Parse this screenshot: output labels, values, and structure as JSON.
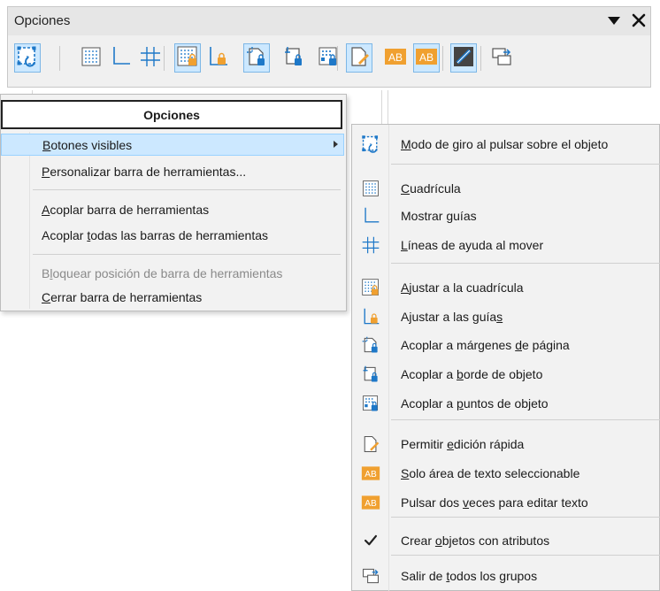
{
  "toolbar": {
    "title": "Opciones",
    "buttons": [
      {
        "icon": "rotate-mode-icon",
        "active": true
      },
      {
        "icon": "grid-icon",
        "active": false
      },
      {
        "icon": "guides-icon",
        "active": false
      },
      {
        "icon": "helplines-icon",
        "active": false
      },
      {
        "icon": "snap-to-grid-icon",
        "active": true
      },
      {
        "icon": "snap-to-guides-icon",
        "active": false
      },
      {
        "icon": "snap-page-margins-icon",
        "active": true
      },
      {
        "icon": "snap-object-border-icon",
        "active": false
      },
      {
        "icon": "snap-object-points-icon",
        "active": false
      },
      {
        "icon": "quick-edit-icon",
        "active": true
      },
      {
        "icon": "text-area-select-icon",
        "active": false
      },
      {
        "icon": "double-click-edit-icon",
        "active": true
      },
      {
        "icon": "create-with-attributes-icon",
        "active": true
      },
      {
        "icon": "exit-groups-icon",
        "active": false
      }
    ]
  },
  "menu": {
    "header": "Opciones",
    "items": {
      "visible_buttons": {
        "pre": "",
        "u": "B",
        "post": "otones visibles"
      },
      "customize": {
        "pre": "",
        "u": "P",
        "post": "ersonalizar barra de herramientas..."
      },
      "dock": {
        "pre": "",
        "u": "A",
        "post": "coplar barra de herramientas"
      },
      "dock_all": {
        "pre": "Acoplar ",
        "u": "t",
        "post": "odas las barras de herramientas"
      },
      "lock": {
        "pre": "B",
        "u": "l",
        "post": "oquear posición de barra de herramientas"
      },
      "close": {
        "pre": "",
        "u": "C",
        "post": "errar barra de herramientas"
      }
    }
  },
  "submenu": {
    "items": [
      {
        "pre": "",
        "u": "M",
        "post": "odo de giro al pulsar sobre el objeto",
        "icon": "rotate-mode-icon"
      },
      {
        "pre": "",
        "u": "C",
        "post": "uadrícula",
        "icon": "grid-icon"
      },
      {
        "pre": "Mostrar ",
        "u": "g",
        "post": "uías",
        "icon": "guides-icon"
      },
      {
        "pre": "",
        "u": "L",
        "post": "íneas de ayuda al mover",
        "icon": "helplines-icon"
      },
      {
        "pre": "",
        "u": "A",
        "post": "justar a la cuadrícula",
        "icon": "snap-to-grid-icon"
      },
      {
        "pre": "Ajustar a las guía",
        "u": "s",
        "post": "",
        "icon": "snap-to-guides-icon"
      },
      {
        "pre": "Acoplar a márgenes ",
        "u": "d",
        "post": "e página",
        "icon": "snap-page-margins-icon"
      },
      {
        "pre": "Acoplar a ",
        "u": "b",
        "post": "orde de objeto",
        "icon": "snap-object-border-icon"
      },
      {
        "pre": "Acoplar a ",
        "u": "p",
        "post": "untos de objeto",
        "icon": "snap-object-points-icon"
      },
      {
        "pre": "Permitir ",
        "u": "e",
        "post": "dición rápida",
        "icon": "quick-edit-icon"
      },
      {
        "pre": "",
        "u": "S",
        "post": "olo área de texto seleccionable",
        "icon": "text-area-select-icon"
      },
      {
        "pre": "Pulsar dos ",
        "u": "v",
        "post": "eces para editar texto",
        "icon": "double-click-edit-icon"
      },
      {
        "pre": "Crear ",
        "u": "o",
        "post": "bjetos con atributos",
        "icon": "checkmark-icon"
      },
      {
        "pre": "Salir de ",
        "u": "t",
        "post": "odos los grupos",
        "icon": "exit-groups-icon"
      }
    ]
  },
  "colors": {
    "active_bg": "#cce8ff",
    "active_border": "#7db7e6",
    "icon_blue": "#1e78c8",
    "icon_orange": "#f0a030",
    "menu_bg": "#f2f2f2"
  }
}
